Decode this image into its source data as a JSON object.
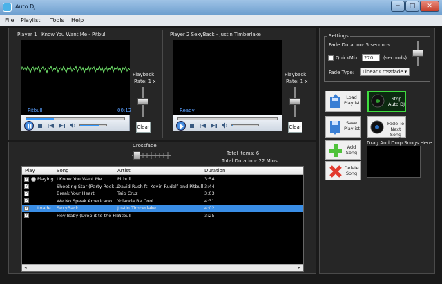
{
  "window": {
    "title": "Auto DJ",
    "min_glyph": "─",
    "max_glyph": "□",
    "close_glyph": "✕"
  },
  "menu": [
    "File",
    "Playlist",
    "Tools",
    "Help"
  ],
  "player1": {
    "header": "Player 1   I Know You Want Me - Pitbull",
    "artist": "Pitbull",
    "time": "00:12",
    "playback_label": "Playback",
    "rate": "Rate: 1 x",
    "clear": "Clear",
    "progress": 0.28,
    "volume": 0.7
  },
  "player2": {
    "header": "Player 2   SexyBack - Justin Timberlake",
    "status": "Ready",
    "playback_label": "Playback",
    "rate": "Rate: 1 x",
    "clear": "Clear",
    "volume": 0.05
  },
  "settings": {
    "title": "Settings",
    "fade_duration": "Fade Duration:  5 seconds",
    "quickmix_label": "QuickMix",
    "quickmix_value": "270",
    "quickmix_unit": "(seconds)",
    "fade_type_label": "Fade Type:",
    "fade_type_value": "Linear Crossfade"
  },
  "buttons": {
    "load_playlist": "Load Playlist",
    "save_playlist": "Save Playlist",
    "add_song": "Add Song",
    "delete_song": "Delete Song",
    "stop_autodj": "Stop Auto DJ",
    "fade_next": "Fade To Next Song"
  },
  "dropzone_label": "Drag And Drop Songs Here",
  "crossfade_label": "Crossfade",
  "totals": {
    "items": "Total Items: 6",
    "duration": "Total Duration: 22 Mins"
  },
  "playlist": {
    "columns": [
      "Play",
      "Song",
      "Artist",
      "Duration"
    ],
    "rows": [
      {
        "checked": true,
        "status": "Playing",
        "song": "I Know You Want Me",
        "artist": "Pitbull",
        "duration": "3:54"
      },
      {
        "checked": true,
        "status": "",
        "song": "Shooting Star (Party Rock ...",
        "artist": "David Rush ft. Kevin Rudolf and Pitbull",
        "duration": "3:44"
      },
      {
        "checked": true,
        "status": "",
        "song": "Break Your Heart",
        "artist": "Taio Cruz",
        "duration": "3:03"
      },
      {
        "checked": true,
        "status": "",
        "song": "We No Speak Americano",
        "artist": "Yolanda Be Cool",
        "duration": "4:31"
      },
      {
        "checked": true,
        "status": "Loade...",
        "song": "SexyBack",
        "artist": "Justin Timberlake",
        "duration": "4:02"
      },
      {
        "checked": true,
        "status": "",
        "song": "Hey Baby (Drop it to the Fl...",
        "artist": "Pitbull",
        "duration": "3:25"
      }
    ]
  },
  "colors": {
    "accent": "#3399ff",
    "waveform": "#6fe06a",
    "selected_row": "#3a8ee6",
    "window_chrome": "#6e9fcf",
    "close": "#c6402b"
  }
}
